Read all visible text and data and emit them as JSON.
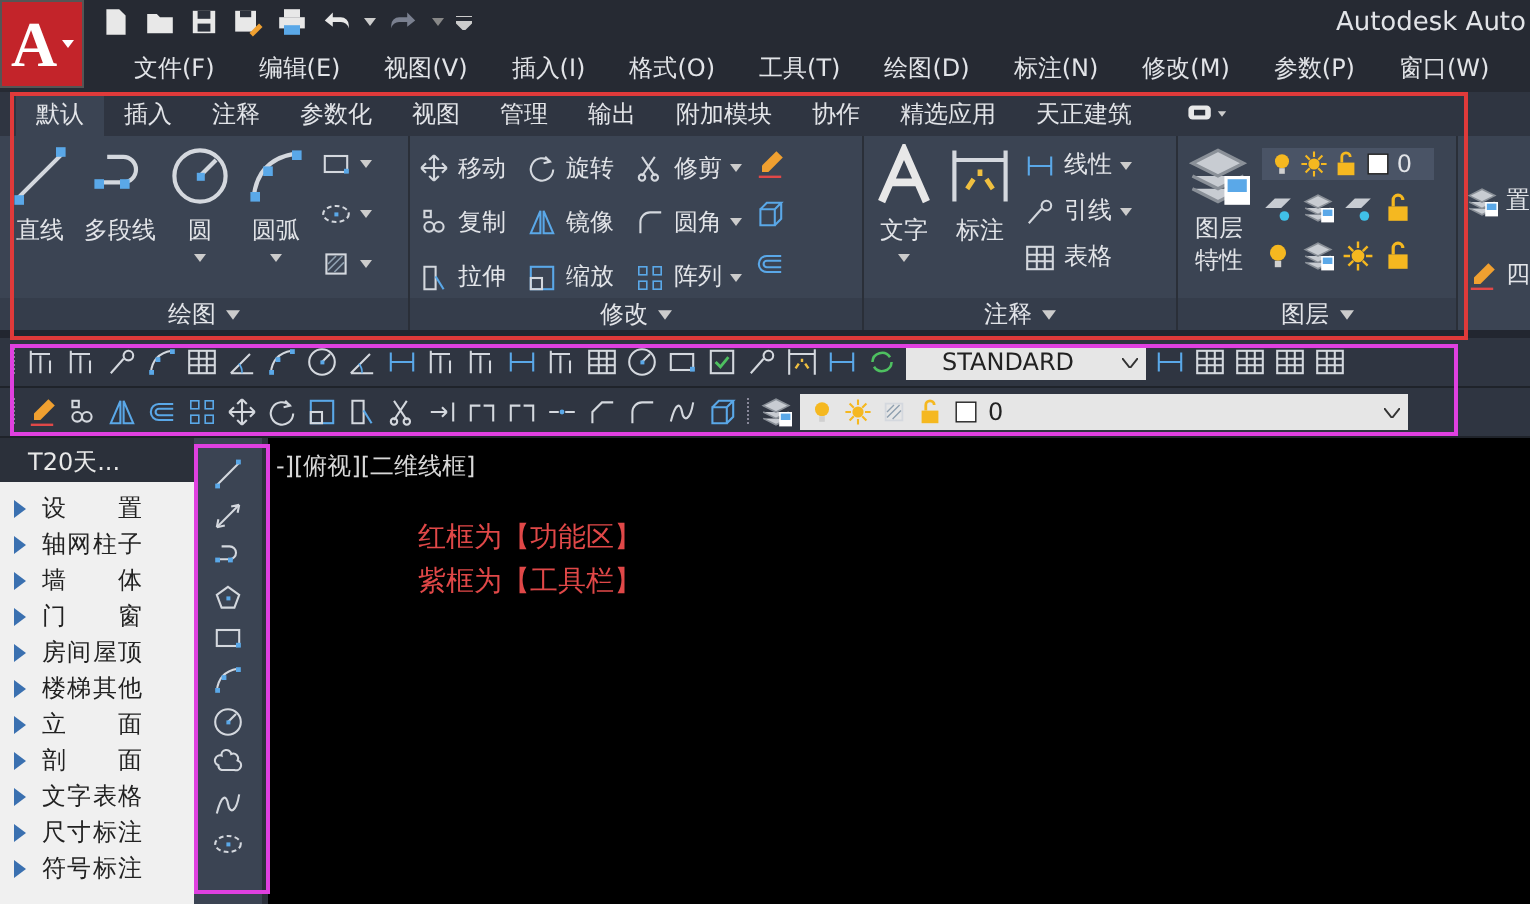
{
  "title_bar": {
    "logo": "A",
    "app_title": "Autodesk Auto"
  },
  "menu_bar": [
    {
      "label": "文件(F)"
    },
    {
      "label": "编辑(E)"
    },
    {
      "label": "视图(V)"
    },
    {
      "label": "插入(I)"
    },
    {
      "label": "格式(O)"
    },
    {
      "label": "工具(T)"
    },
    {
      "label": "绘图(D)"
    },
    {
      "label": "标注(N)"
    },
    {
      "label": "修改(M)"
    },
    {
      "label": "参数(P)"
    },
    {
      "label": "窗口(W)"
    }
  ],
  "ribbon": {
    "tabs": [
      {
        "label": "默认",
        "selected": true
      },
      {
        "label": "插入",
        "selected": false
      },
      {
        "label": "注释",
        "selected": false
      },
      {
        "label": "参数化",
        "selected": false
      },
      {
        "label": "视图",
        "selected": false
      },
      {
        "label": "管理",
        "selected": false
      },
      {
        "label": "输出",
        "selected": false
      },
      {
        "label": "附加模块",
        "selected": false
      },
      {
        "label": "协作",
        "selected": false
      },
      {
        "label": "精选应用",
        "selected": false
      },
      {
        "label": "天正建筑",
        "selected": false
      }
    ],
    "panels": [
      {
        "title": "绘图",
        "large_tools": [
          {
            "label": "直线",
            "dropdown": false
          },
          {
            "label": "多段线",
            "dropdown": false
          },
          {
            "label": "圆",
            "dropdown": true
          },
          {
            "label": "圆弧",
            "dropdown": true
          }
        ]
      },
      {
        "title": "修改",
        "tools": [
          {
            "label": "移动",
            "dropdown": false
          },
          {
            "label": "旋转",
            "dropdown": false
          },
          {
            "label": "修剪",
            "dropdown": true
          },
          {
            "label": "复制",
            "dropdown": false
          },
          {
            "label": "镜像",
            "dropdown": false
          },
          {
            "label": "圆角",
            "dropdown": true
          },
          {
            "label": "拉伸",
            "dropdown": false
          },
          {
            "label": "缩放",
            "dropdown": false
          },
          {
            "label": "阵列",
            "dropdown": true
          }
        ]
      },
      {
        "title": "注释",
        "large_tools": [
          {
            "label": "文字",
            "dropdown": true
          },
          {
            "label": "标注",
            "dropdown": false
          }
        ],
        "tools": [
          {
            "label": "线性",
            "dropdown": true
          },
          {
            "label": "引线",
            "dropdown": true
          },
          {
            "label": "表格",
            "dropdown": false
          }
        ]
      },
      {
        "title": "图层",
        "large_tools": [
          {
            "label": "图层特性"
          }
        ],
        "layer_value": "0"
      }
    ],
    "cut_tools": [
      {
        "label": "置"
      },
      {
        "label": "四"
      }
    ]
  },
  "toolbars": {
    "text_style": "STANDARD",
    "layer_value": "0"
  },
  "palette": {
    "title": "T20天...",
    "items": [
      {
        "label": "设　置"
      },
      {
        "label": "轴网柱子"
      },
      {
        "label": "墙　体"
      },
      {
        "label": "门　窗"
      },
      {
        "label": "房间屋顶"
      },
      {
        "label": "楼梯其他"
      },
      {
        "label": "立　面"
      },
      {
        "label": "剖　面"
      },
      {
        "label": "文字表格"
      },
      {
        "label": "尺寸标注"
      },
      {
        "label": "符号标注"
      }
    ]
  },
  "viewport": {
    "label": "-][俯视][二维线框]",
    "notes": [
      {
        "text": "红框为【功能区】"
      },
      {
        "text": "紫框为【工具栏】"
      }
    ]
  }
}
